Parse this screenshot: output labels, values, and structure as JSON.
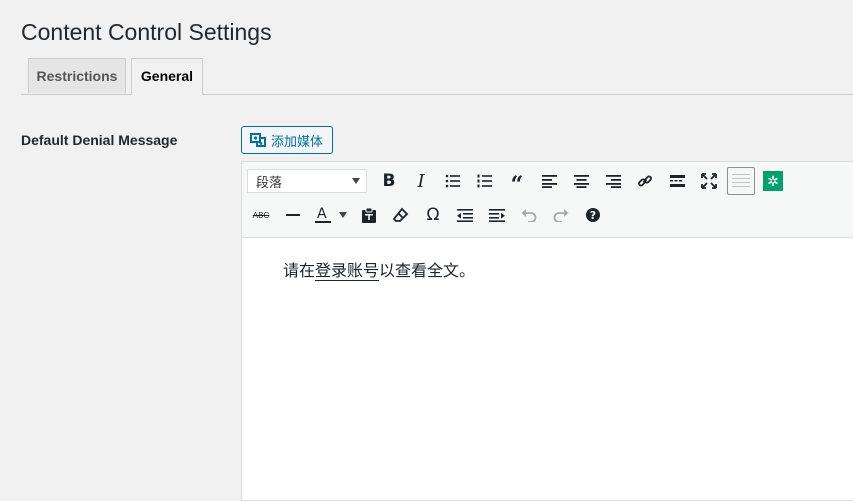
{
  "page": {
    "title": "Content Control Settings"
  },
  "tabs": [
    {
      "label": "Restrictions",
      "active": false
    },
    {
      "label": "General",
      "active": true
    }
  ],
  "field": {
    "label": "Default Denial Message"
  },
  "media_button": {
    "label": "添加媒体",
    "icon": "media-icon"
  },
  "toolbar": {
    "format_select": {
      "selected": "段落"
    },
    "row1_icons": [
      "bold-icon",
      "italic-icon",
      "bullet-list-icon",
      "numbered-list-icon",
      "blockquote-icon",
      "align-left-icon",
      "align-center-icon",
      "align-right-icon",
      "link-icon",
      "read-more-icon",
      "fullscreen-icon",
      "toolbar-toggle-icon",
      "plugin-gear-icon"
    ],
    "row2_icons": [
      "strikethrough-icon",
      "horizontal-line-icon",
      "text-color-icon",
      "paste-text-icon",
      "clear-formatting-icon",
      "special-character-icon",
      "outdent-icon",
      "indent-icon",
      "undo-icon",
      "redo-icon",
      "help-icon"
    ],
    "accent_color": "#00a36c"
  },
  "editor": {
    "text_before": "请在",
    "text_underlined": "登录账号",
    "text_after": "以查看全文。"
  }
}
